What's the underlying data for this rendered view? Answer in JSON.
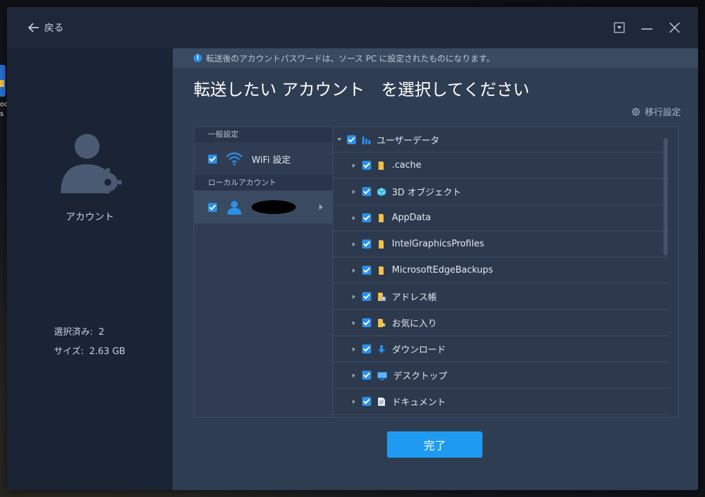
{
  "desktop": {
    "icon_label_1": "od",
    "icon_label_2": "s"
  },
  "titlebar": {
    "back_label": "戻る"
  },
  "sidebar": {
    "title": "アカウント",
    "selected_label": "選択済み:",
    "selected_value": "2",
    "size_label": "サイズ:",
    "size_value": "2.63 GB"
  },
  "main": {
    "info_text": "転送後のアカウントパスワードは、ソース PC に設定されたものになります。",
    "heading": "転送したい アカウント　を選択してください",
    "settings_label": "移行設定",
    "left_pane": {
      "general_header": "一般設定",
      "wifi_label": "WiFi 設定",
      "local_header": "ローカルアカウント"
    },
    "tree": {
      "root_label": "ユーザーデータ",
      "items": [
        {
          "label": ".cache",
          "icon": "folder-icon"
        },
        {
          "label": "3D オブジェクト",
          "icon": "3d-cube-icon"
        },
        {
          "label": "AppData",
          "icon": "folder-icon"
        },
        {
          "label": "IntelGraphicsProfiles",
          "icon": "folder-icon"
        },
        {
          "label": "MicrosoftEdgeBackups",
          "icon": "folder-icon"
        },
        {
          "label": "アドレス帳",
          "icon": "contacts-folder-icon"
        },
        {
          "label": "お気に入り",
          "icon": "favorites-folder-icon"
        },
        {
          "label": "ダウンロード",
          "icon": "download-arrow-icon"
        },
        {
          "label": "デスクトップ",
          "icon": "desktop-icon"
        },
        {
          "label": "ドキュメント",
          "icon": "document-icon"
        }
      ]
    },
    "done_label": "完了"
  },
  "colors": {
    "accent": "#1e9bf0",
    "checkbox": "#2b8fe8",
    "window_bg": "#1b2433",
    "panel_bg": "#2f3d52"
  }
}
